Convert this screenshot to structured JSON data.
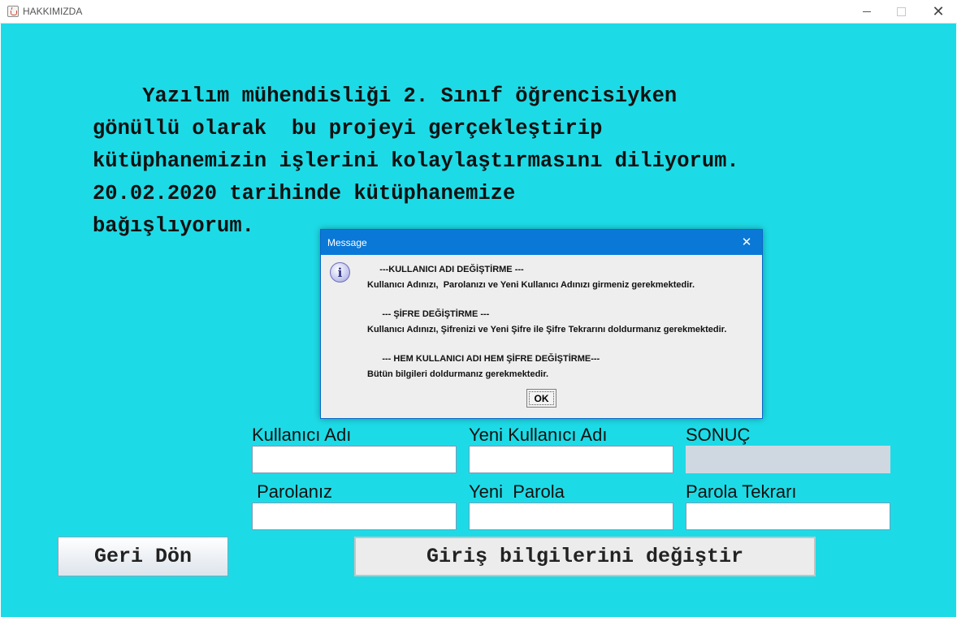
{
  "window": {
    "title": "HAKKIMIZDA",
    "controls": [
      "minimize",
      "maximize",
      "close"
    ],
    "close_glyph": "✕"
  },
  "about": {
    "text": "    Yazılım mühendisliği 2. Sınıf öğrencisiyken\ngönüllü olarak  bu projeyi gerçekleştirip\nkütüphanemizin işlerini kolaylaştırmasını diliyorum.\n20.02.2020 tarihinde kütüphanemize\nbağışlıyorum."
  },
  "form": {
    "labels": {
      "username": "Kullanıcı Adı",
      "new_username": "Yeni Kullanıcı Adı",
      "result": "SONUÇ",
      "password": " Parolanız",
      "new_password": "Yeni  Parola",
      "password_repeat": "Parola Tekrarı"
    },
    "values": {
      "username": "",
      "new_username": "",
      "result": "",
      "password": "",
      "new_password": "",
      "password_repeat": ""
    }
  },
  "buttons": {
    "back": "Geri Dön",
    "change": "Giriş bilgilerini değiştir"
  },
  "dialog": {
    "title": "Message",
    "icon": "info-icon",
    "lines": [
      "     ---KULLANICI ADI DEĞİŞTİRME ---",
      "Kullanıcı Adınızı,  Parolanızı ve Yeni Kullanıcı Adınızı girmeniz gerekmektedir.",
      "      --- ŞİFRE DEĞİŞTİRME ---",
      "Kullanıcı Adınızı, Şifrenizi ve Yeni Şifre ile Şifre Tekrarını doldurmanız gerekmektedir.",
      "      --- HEM KULLANICI ADI HEM ŞİFRE DEĞİŞTİRME---",
      "Bütün bilgileri doldurmanız gerekmektedir."
    ],
    "ok_label": "OK"
  },
  "colors": {
    "background": "#1ddbe6",
    "dialog_title_bar": "#0a78d7",
    "result_field": "#cfd8e0"
  }
}
